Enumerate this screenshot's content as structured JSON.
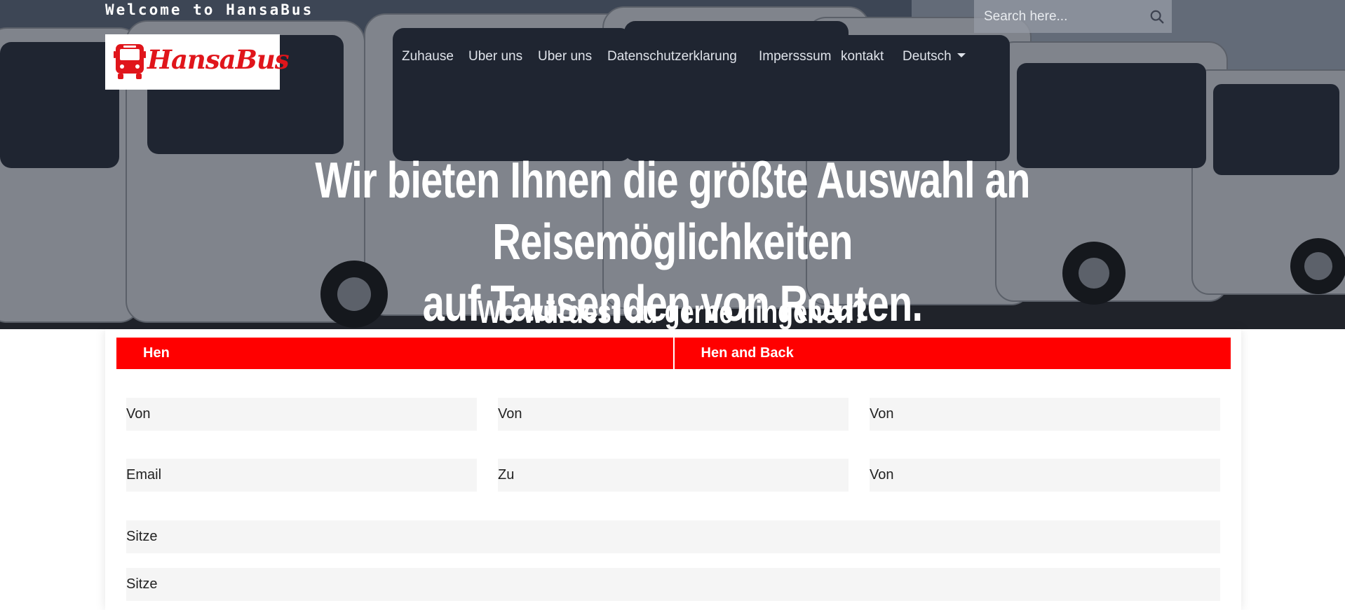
{
  "header": {
    "welcome": "Welcome to HansaBus",
    "search_placeholder": "Search here...",
    "logo_text": "HansaBus"
  },
  "nav": {
    "items": [
      {
        "label": "Zuhause"
      },
      {
        "label": "Uber uns"
      },
      {
        "label": "Uber uns"
      },
      {
        "label": "Datenschutzerklarung"
      },
      {
        "label": "Impersssum"
      },
      {
        "label": "kontakt"
      },
      {
        "label": "Deutsch"
      }
    ]
  },
  "hero": {
    "headline_line1": "Wir bieten Ihnen die größte Auswahl an Reisemöglichkeiten",
    "headline_line2": "auf Tausenden von Routen.",
    "subheadline": "Wo würdest du gerne hingehen?"
  },
  "booking": {
    "tabs": [
      {
        "label": "Hen"
      },
      {
        "label": "Hen and Back"
      }
    ],
    "fields": {
      "row1_col1": "Von",
      "row1_col2": "Von",
      "row1_col3": "Von",
      "row2_col1": "Email",
      "row2_col2": "Zu",
      "row2_col3": "Von",
      "row3": "Sitze",
      "row4": "Sitze"
    }
  },
  "colors": {
    "brand_red": "#ff0000",
    "logo_red": "#e0151b",
    "field_bg": "#f5f5f5"
  },
  "icons": {
    "search": "search-icon",
    "logo": "bus-icon"
  }
}
